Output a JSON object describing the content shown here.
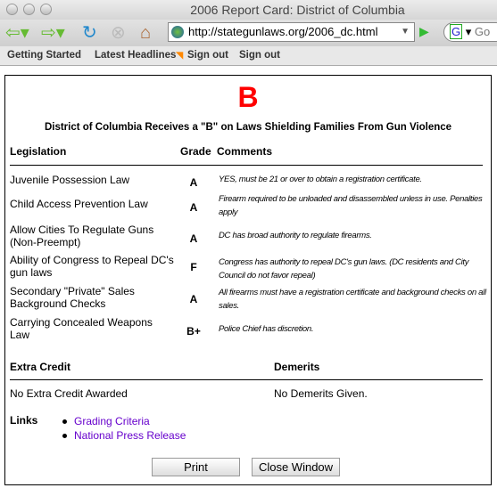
{
  "window": {
    "title": "2006 Report Card: District of Columbia"
  },
  "toolbar": {
    "url": "http://stategunlaws.org/2006_dc.html",
    "search_engine": "G",
    "search_text": "Go"
  },
  "bookmarks": [
    "Getting Started",
    "Latest Headlines",
    "Sign out",
    "Sign out"
  ],
  "page": {
    "grade": "B",
    "headline": "District of Columbia Receives a \"B\" on Laws Shielding Families From Gun Violence",
    "columns": {
      "legislation": "Legislation",
      "grade": "Grade",
      "comments": "Comments"
    },
    "rows": [
      {
        "law": "Juvenile Possession Law",
        "grade": "A",
        "comment": "YES, must be 21 or over to obtain a registration certificate."
      },
      {
        "law": "Child Access Prevention Law",
        "grade": "A",
        "comment": "Firearm required to be unloaded and disassembled unless in use. Penalties apply"
      },
      {
        "law": "Allow Cities To Regulate Guns (Non-Preempt)",
        "grade": "A",
        "comment": "DC has broad authority to regulate firearms."
      },
      {
        "law": "Ability of Congress to Repeal DC's gun laws",
        "grade": "F",
        "comment": "Congress has authority to repeal DC's gun laws. (DC residents and City Council do not favor repeal)"
      },
      {
        "law": "Secondary \"Private\" Sales Background Checks",
        "grade": "A",
        "comment": "All firearms must have a registration certificate and background checks on all sales."
      },
      {
        "law": "Carrying Concealed Weapons Law",
        "grade": "B+",
        "comment": "Police Chief has discretion."
      }
    ],
    "extra_credit": {
      "label": "Extra Credit",
      "value": "No Extra Credit Awarded"
    },
    "demerits": {
      "label": "Demerits",
      "value": "No Demerits Given."
    },
    "links": {
      "label": "Links",
      "items": [
        "Grading Criteria",
        "National Press Release"
      ]
    },
    "buttons": {
      "print": "Print",
      "close": "Close Window"
    }
  }
}
